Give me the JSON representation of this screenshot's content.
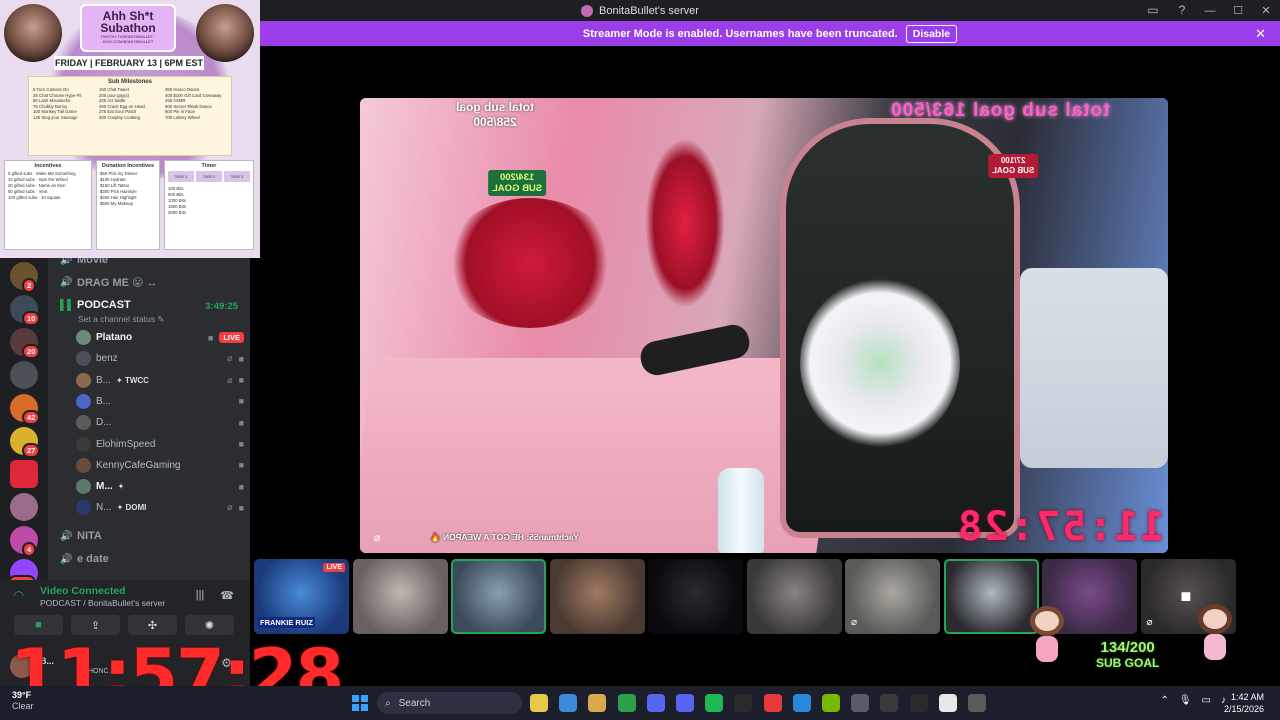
{
  "window": {
    "title": "BonitaBullet's server",
    "controls": [
      "minimize",
      "maximize",
      "close"
    ]
  },
  "banner": {
    "message": "Streamer Mode is enabled. Usernames have been truncated.",
    "disable_label": "Disable"
  },
  "poster": {
    "headline": "Ahh Sh*t Subathon",
    "headline_small": "TWITCH.TV/BONITABULLET · KICK.COM/BONITABULLET",
    "date": "FRIDAY | FEBRUARY 13 | 6PM EST",
    "milestones_title": "Sub Milestones",
    "milestones": [
      [
        "5 Turn Camera On",
        "25 Chat Choose Hype-Fit",
        "50 Lash Moustache",
        "75 Chubby Bunny",
        "100 Monkey Tail Game",
        "125 Sing your Sausage"
      ],
      [
        "150 Chat Tweet",
        "200 pour gay(s)",
        "225 Arz battle",
        "250 Crack Egg on Head",
        "275 Eat Sour Patch",
        "300 Cosplay Cooking"
      ],
      [
        "350 Hunco Dance",
        "400 $100 Gift Card Giveaway",
        "450 ASMR",
        "500 Secret Tiktok Dance",
        "600 Pie in Face",
        "700 Lottery Wheel"
      ]
    ],
    "incentives_title": "Incentives",
    "incentives": [
      "5 gifted subs · Make Me Something",
      "10 gifted subs · Spin the Wheel",
      "20 gifted subs · Name an Item",
      "50 gifted subs · Vent",
      "100 gifted subs · 10 Squats"
    ],
    "donation_title": "Donation Incentives",
    "donations": [
      "$50 Pick my Dinner",
      "$100 Hydrate",
      "$150 Lift Tattoo",
      "$300 Pick Hairstyle",
      "$400 Hair Highlight",
      "$500 My Makeup"
    ],
    "timer_title": "Timer",
    "tiers": [
      "TIER 1",
      "TIER 2",
      "TIER 3"
    ],
    "bits": [
      "100 Bits",
      "500 Bits",
      "1000 Bits",
      "1500 Bits",
      "2000 Bits"
    ]
  },
  "server_rail": [
    {
      "badge": "2",
      "color": "#6b5330"
    },
    {
      "badge": "10",
      "color": "#3d4a5a"
    },
    {
      "badge": "20",
      "color": "#5a3b3b"
    },
    {
      "badge": "",
      "color": "#4b4f56"
    },
    {
      "badge": "42",
      "color": "#d66b2a"
    },
    {
      "badge": "27",
      "color": "#d9b12a"
    },
    {
      "badge": "",
      "color": "#e0263a"
    },
    {
      "badge": "",
      "color": "#9c6b8a"
    },
    {
      "badge": "4",
      "color": "#c04aa8"
    },
    {
      "badge": "NEW",
      "color": "#9146ff"
    }
  ],
  "channels": {
    "movie": "Movie",
    "drag_me": "DRAG ME 😛 ↔",
    "podcast": "PODCAST",
    "podcast_duration": "3:49:25",
    "status": "Set a channel status ✎",
    "members": [
      {
        "name": "Platano",
        "live": "LIVE",
        "tag": "",
        "color": "#6b8a7a",
        "bold": true
      },
      {
        "name": "benz",
        "live": "",
        "tag": "",
        "color": "#4a4f5a",
        "bold": false
      },
      {
        "name": "B...",
        "live": "",
        "tag": "✦ TWCC",
        "color": "#8a6a4a",
        "bold": false
      },
      {
        "name": "B...",
        "live": "",
        "tag": "",
        "color": "#4a66c8",
        "bold": false
      },
      {
        "name": "D...",
        "live": "",
        "tag": "",
        "color": "#5a5a5a",
        "bold": false
      },
      {
        "name": "ElohimSpeed",
        "live": "",
        "tag": "",
        "color": "#3a3a3a",
        "bold": false
      },
      {
        "name": "KennyCafeGaming",
        "live": "",
        "tag": "",
        "color": "#6a4a3a",
        "bold": false
      },
      {
        "name": "M...",
        "live": "",
        "tag": "✦",
        "color": "#5a7a6a",
        "bold": true
      },
      {
        "name": "N...",
        "live": "",
        "tag": "✦ DOMI",
        "color": "#2a3a6a",
        "bold": false
      }
    ],
    "nita": "NITA",
    "e_date": "e date"
  },
  "voice": {
    "title": "Video Connected",
    "subtitle": "PODCAST / BonitaBullet's server"
  },
  "user": {
    "name": "B...",
    "status": "HONC..."
  },
  "overlay": {
    "big_timer": "11:57:28",
    "stage_timer": "11:57:28",
    "goal_top": "total sub goal 163/500",
    "goal_left_line1": "total sub goal",
    "goal_left_line2": "258/500",
    "badge_left_line1": "134/200",
    "badge_left_line2": "SUB GOAL",
    "badge_right_line1": "27/100",
    "badge_right_line2": "SUB GOAL",
    "caption": "Yachtman55: HE GOT A WEAPON 🔥",
    "subgoal_count": "134/200",
    "subgoal_label": "SUB GOAL"
  },
  "tiles": [
    {
      "colors": [
        "#1a3a7a",
        "#4a8ad8"
      ],
      "live": "LIVE",
      "banner": "FRANKIE RUIZ"
    },
    {
      "colors": [
        "#6a6060",
        "#c0b8b0"
      ],
      "live": "",
      "banner": ""
    },
    {
      "colors": [
        "#3a4a5a",
        "#8aa0b0"
      ],
      "live": "",
      "banner": ""
    },
    {
      "colors": [
        "#4a3a32",
        "#a07a60"
      ],
      "live": "",
      "banner": ""
    },
    {
      "colors": [
        "#0a0a0e",
        "#2a2a30"
      ],
      "live": "",
      "banner": ""
    },
    {
      "colors": [
        "#3a3838",
        "#8a8484"
      ],
      "live": "",
      "banner": ""
    },
    {
      "colors": [
        "#5a5a58",
        "#aaa8a0"
      ],
      "live": "",
      "banner": ""
    },
    {
      "colors": [
        "#2a2a30",
        "#b0b8c0"
      ],
      "live": "",
      "banner": ""
    },
    {
      "colors": [
        "#3a2a44",
        "#7a4a8a"
      ],
      "live": "",
      "banner": ""
    },
    {
      "colors": [
        "#2a2a2a",
        "#5a5050"
      ],
      "live": "",
      "banner": ""
    }
  ],
  "taskbar": {
    "weather_temp": "39°F",
    "weather_cond": "Clear",
    "search_placeholder": "Search",
    "apps": [
      "#e8c84a",
      "#3a8ad8",
      "#d8a84a",
      "#2aa04a",
      "#5865f2",
      "#5865f2",
      "#1db954",
      "#2a2a2a",
      "#e83a3a",
      "#2a88d8",
      "#76b900",
      "#5a5a6a",
      "#3a3a3a",
      "#2a2a2a",
      "#e8e8e8",
      "#5a5a5a"
    ],
    "time": "1:42 AM",
    "date": "2/15/2026"
  }
}
